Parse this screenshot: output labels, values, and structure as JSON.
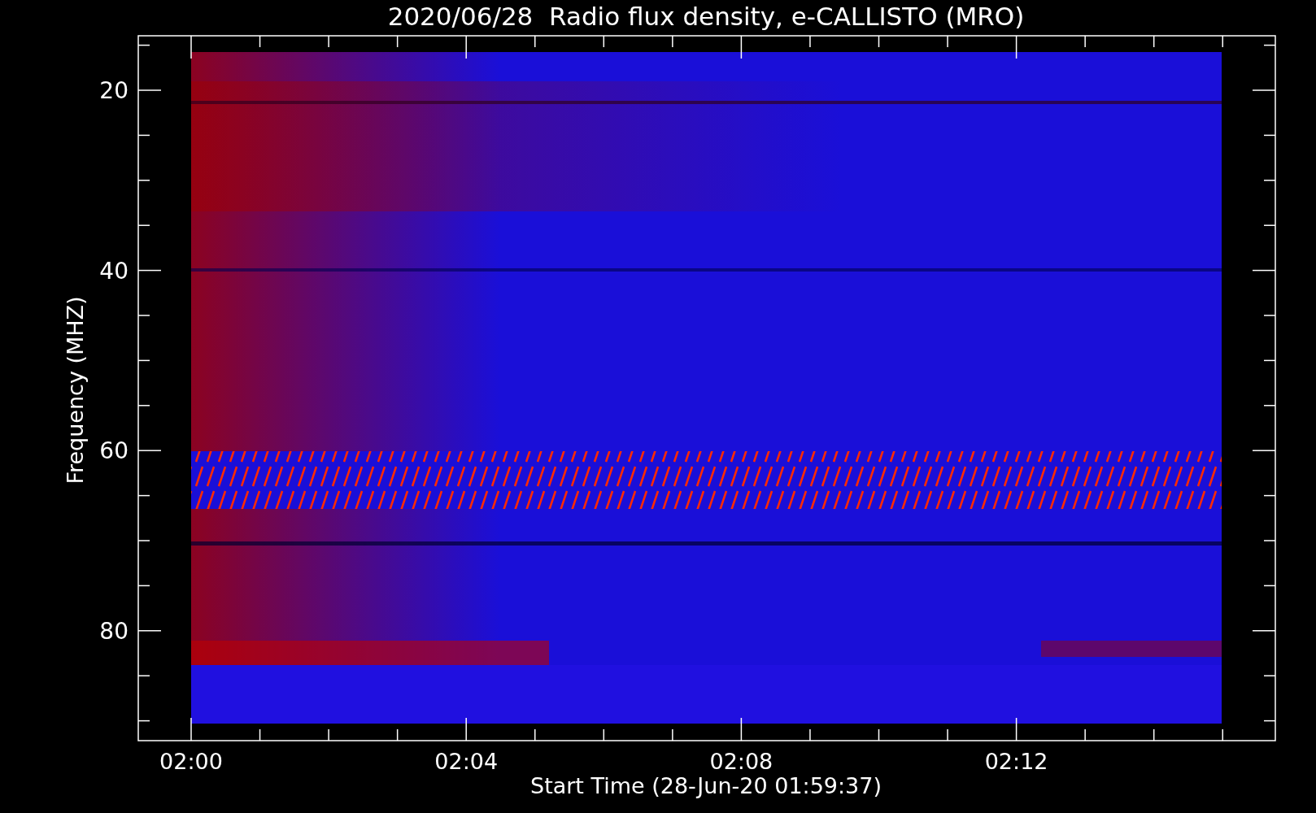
{
  "title": "2020/06/28  Radio flux density, e-CALLISTO (MRO)",
  "y_axis": {
    "label": "Frequency (MHZ)",
    "tick_labels": [
      "20",
      "40",
      "60",
      "80"
    ]
  },
  "x_axis": {
    "label": "Start Time (28-Jun-20 01:59:37)",
    "tick_labels": [
      "02:00",
      "02:04",
      "02:08",
      "02:12"
    ]
  }
}
